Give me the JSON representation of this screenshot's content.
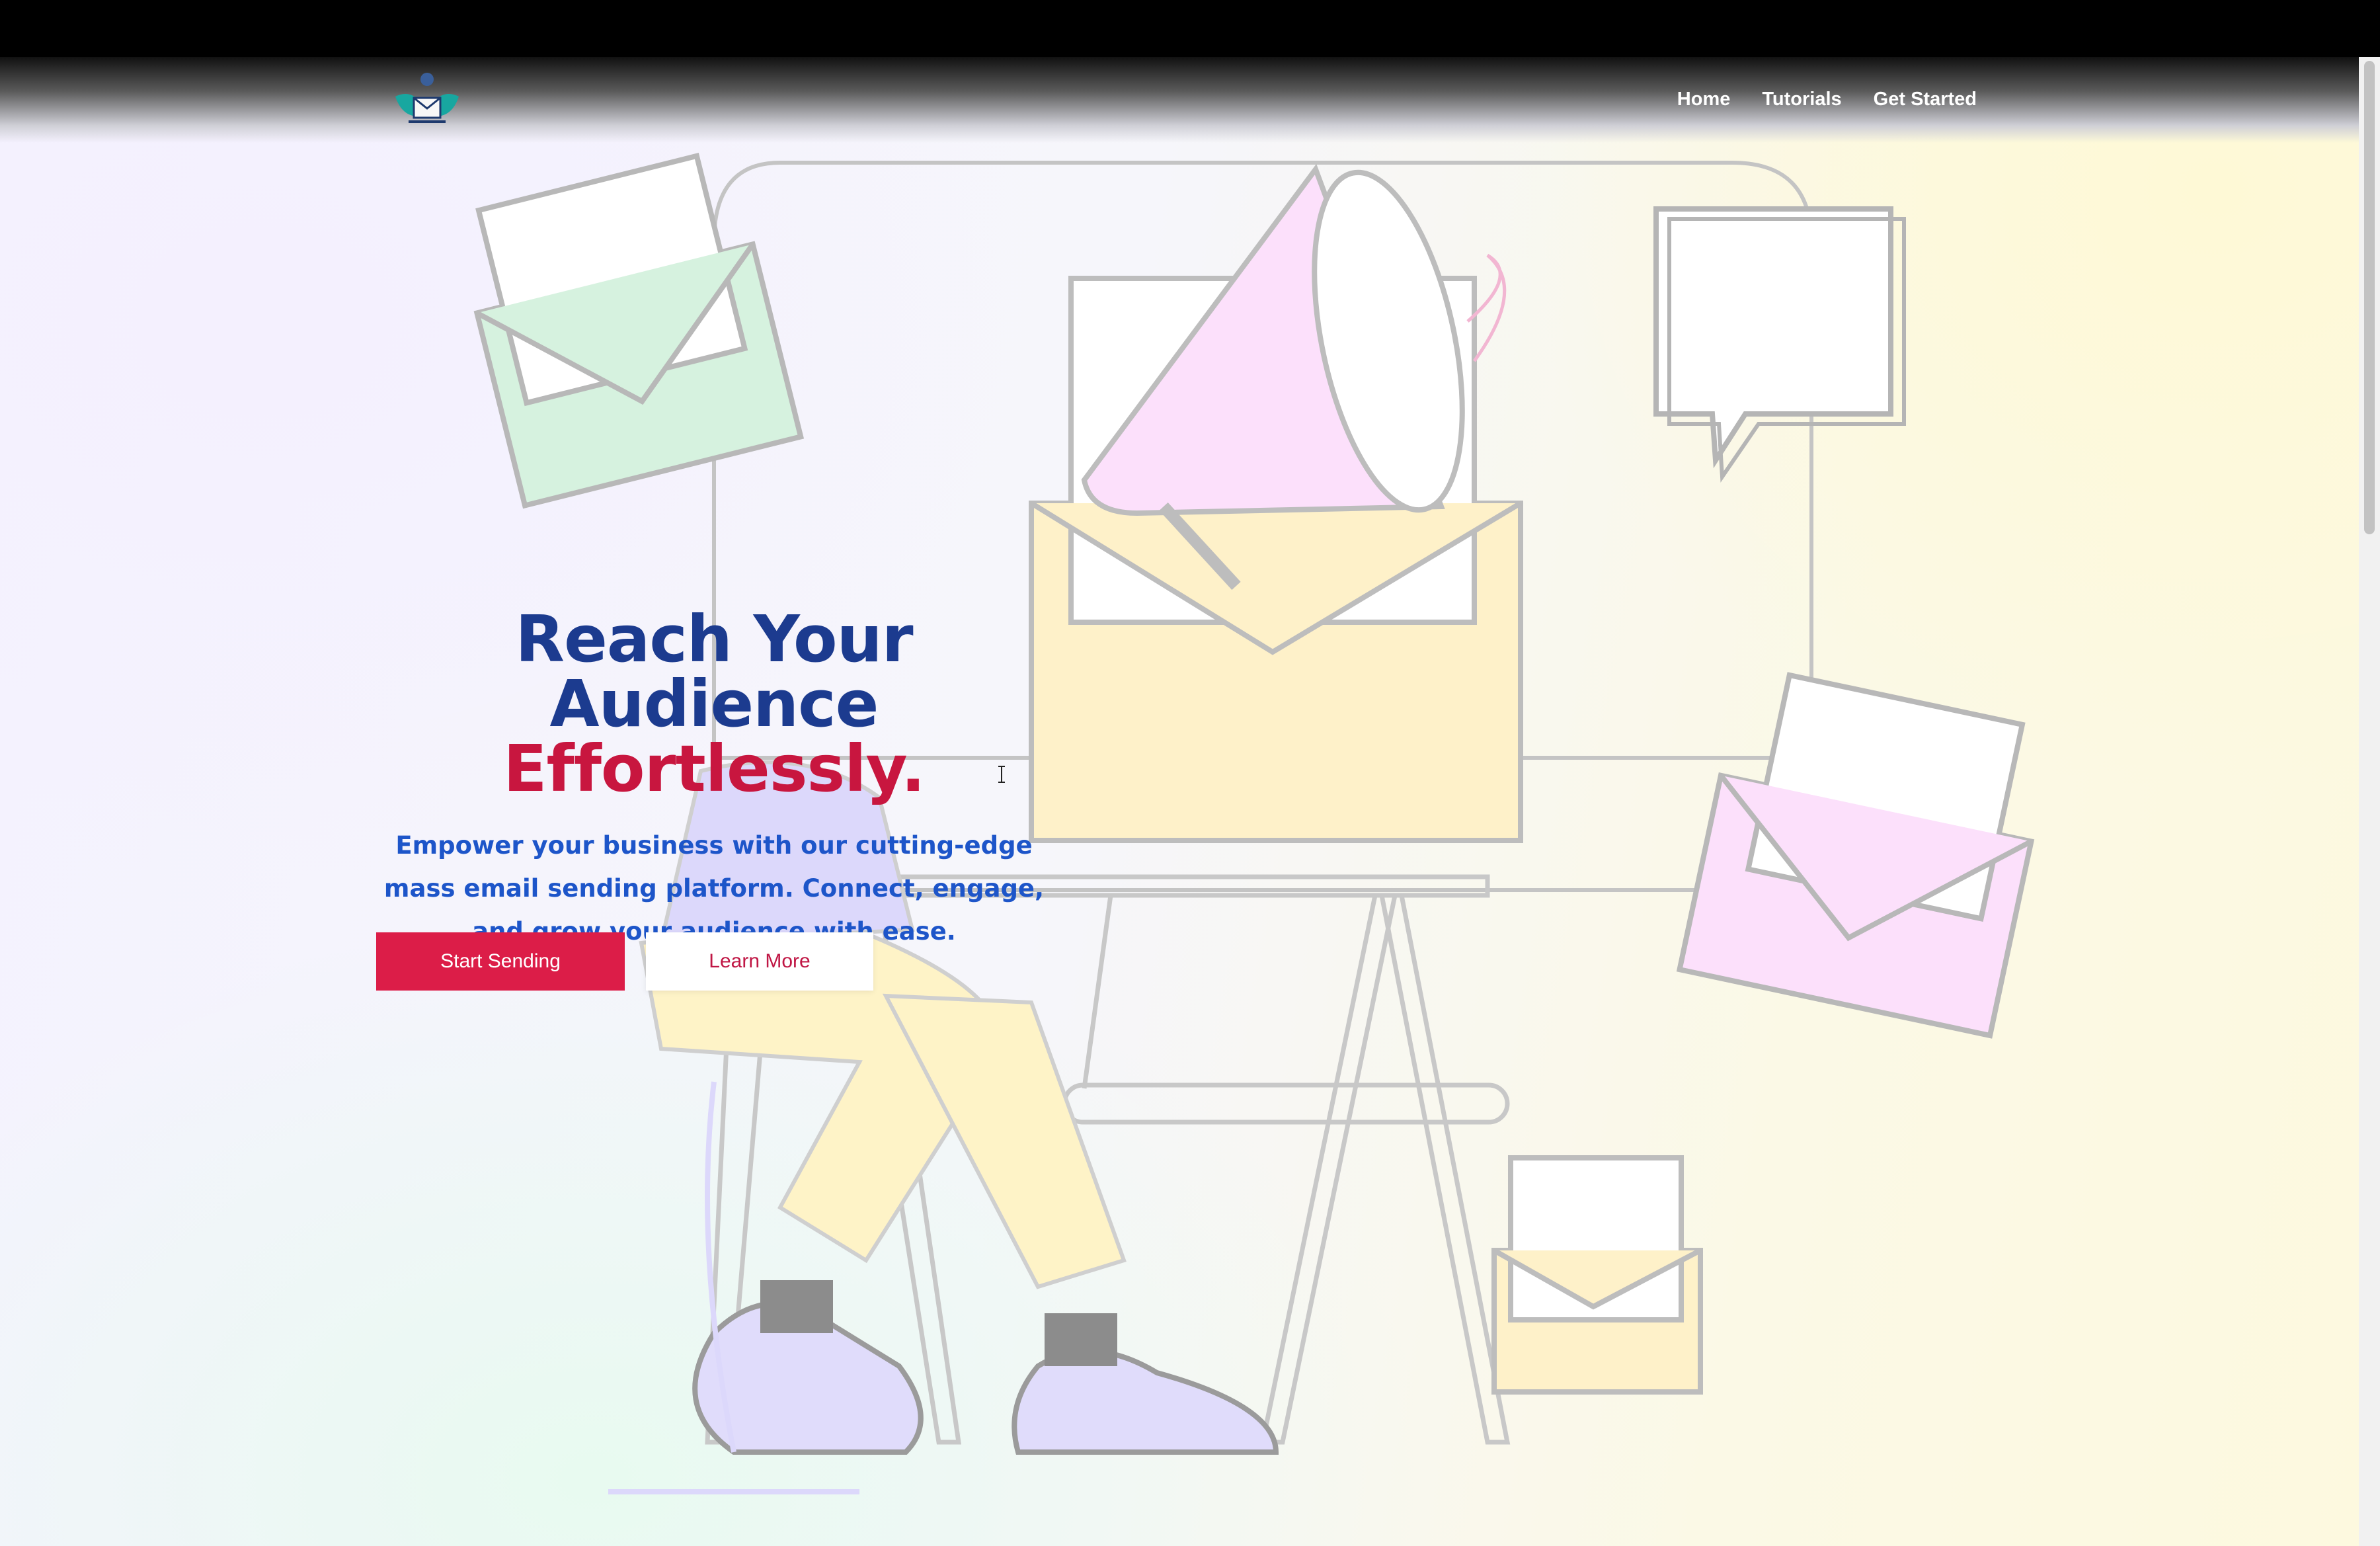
{
  "nav": {
    "logo_icon": "winged-envelope-logo",
    "links": [
      "Home",
      "Tutorials",
      "Get Started"
    ]
  },
  "hero": {
    "title_line1": "Reach Your Audience",
    "title_line2": "Effortlessly.",
    "subtitle": "Empower your business with our cutting-edge mass email sending platform. Connect, engage, and grow your audience with ease.",
    "primary_button": "Start Sending",
    "secondary_button": "Learn More"
  },
  "colors": {
    "title_blue": "#1c3b8f",
    "title_accent": "#c8163f",
    "subtitle_blue": "#1d55c9",
    "primary_button": "#dc1d48"
  },
  "illustration": {
    "icons": [
      "monitor-icon",
      "megaphone-icon",
      "envelope-icon",
      "speech-bubble-icon",
      "person-at-desk-icon"
    ]
  }
}
